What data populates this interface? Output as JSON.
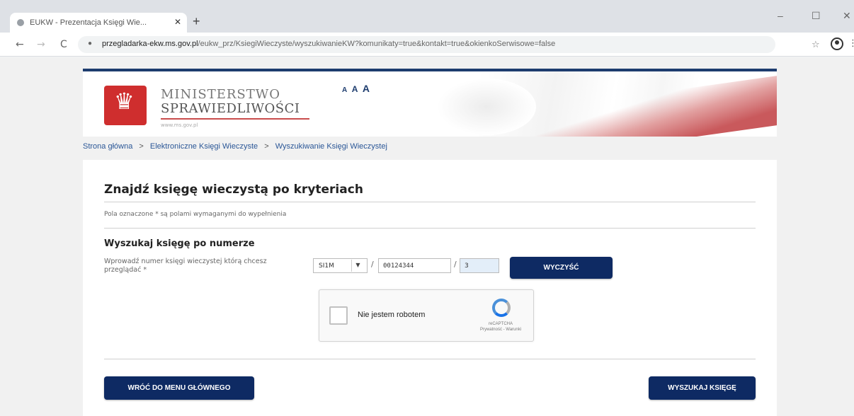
{
  "browser": {
    "tab_title": "EUKW - Prezentacja Księgi Wie...",
    "tab_close": "✕",
    "new_tab": "+",
    "window_min": "–",
    "window_max": "☐",
    "window_close": "✕",
    "back": "←",
    "forward": "→",
    "reload": "C",
    "url_host": "przegladarka-ekw.ms.gov.pl",
    "url_path": "/eukw_prz/KsiegiWieczyste/wyszukiwanieKW?komunikaty=true&kontakt=true&okienkoSerwisowe=false",
    "star": "☆",
    "menu": "⋮"
  },
  "header": {
    "ministry_line1": "MINISTERSTWO",
    "ministry_line2": "SPRAWIEDLIWOŚCI",
    "ministry_url": "www.ms.gov.pl",
    "font_a_small": "A",
    "font_a_medium": "A",
    "font_a_large": "A"
  },
  "breadcrumb": {
    "items": [
      "Strona główna",
      "Elektroniczne Księgi Wieczyste",
      "Wyszukiwanie Księgi Wieczystej"
    ],
    "separator": ">"
  },
  "form": {
    "title": "Znajdź księgę wieczystą po kryteriach",
    "required_note": "Pola oznaczone * są polami wymaganymi do wypełnienia",
    "section_title": "Wyszukaj księgę po numerze",
    "field_label": "Wprowadź numer księgi wieczystej którą chcesz przeglądać *",
    "kw_prefix": "SI1M",
    "kw_number": "00124344",
    "kw_check": "3",
    "slash": "/",
    "clear_button": "WYCZYŚĆ",
    "back_button": "WRÓĆ DO MENU GŁÓWNEGO",
    "search_button": "WYSZUKAJ KSIĘGĘ"
  },
  "recaptcha": {
    "label": "Nie jestem robotem",
    "brand": "reCAPTCHA",
    "links": "Prywatność - Warunki"
  },
  "colors": {
    "primary_navy": "#0e2a63",
    "header_border": "#1d3c6e",
    "link_blue": "#2b5797",
    "emblem_red": "#cf2e2e"
  }
}
